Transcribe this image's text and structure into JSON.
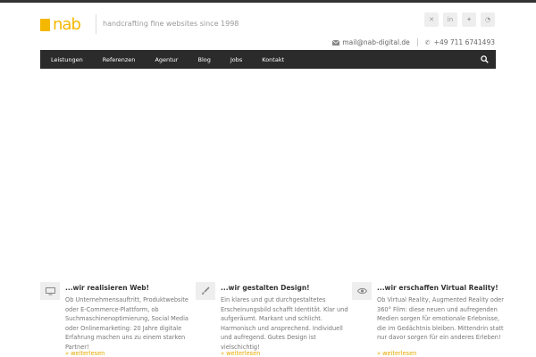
{
  "header": {
    "logo_text": "nab",
    "tagline": "handcrafting fine websites since 1998",
    "social": [
      {
        "icon": "xing-icon",
        "glyph": "✕"
      },
      {
        "icon": "linkedin-icon",
        "glyph": "in"
      },
      {
        "icon": "twitter-icon",
        "glyph": "✦"
      },
      {
        "icon": "rss-icon",
        "glyph": "◔"
      }
    ],
    "email": "mail@nab-digital.de",
    "phone": "+49 711 6741493"
  },
  "nav": {
    "items": [
      "Leistungen",
      "Referenzen",
      "Agentur",
      "Blog",
      "Jobs",
      "Kontakt"
    ]
  },
  "features": [
    {
      "icon": "monitor-icon",
      "title": "...wir realisieren Web!",
      "text": "Ob Unternehmensauftritt, Produktwebsite oder E-Commerce-Plattform, ob Suchmaschinenoptimierung, Social Media oder Onlinemarketing: 20 Jahre digitale Erfahrung machen uns zu einem starken Partner!",
      "more": "» weiterlesen"
    },
    {
      "icon": "brush-icon",
      "title": "...wir gestalten Design!",
      "text": "Ein klares und gut durchgestaltetes Erscheinungsbild schafft Identität. Klar und aufgeräumt. Markant und schlicht. Harmonisch und ansprechend. Individuell und aufregend. Gutes Design ist vielschichtig!",
      "more": "» weiterlesen"
    },
    {
      "icon": "eye-icon",
      "title": "...wir erschaffen Virtual Reality!",
      "text": "Ob Virtual Reality, Augmented Reality oder 360° Film: diese neuen und aufregenden Medien sorgen für emotionale Erlebnisse, die im Gedächtnis bleiben. Mittendrin statt nur davor sorgen für ein anderes Erleben!",
      "more": "» weiterlesen"
    }
  ],
  "colors": {
    "brand": "#f5b800",
    "nav_bg": "#2b2b2b",
    "link": "#e6a800"
  }
}
